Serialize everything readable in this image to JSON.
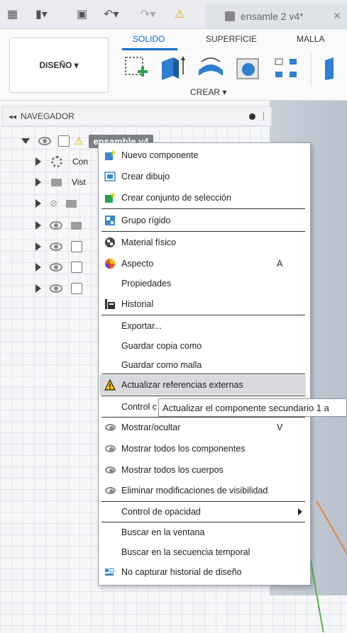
{
  "titlebar": {
    "document_tab": "ensamle 2 v4*",
    "close_glyph": "✕"
  },
  "ribbon": {
    "tabs": [
      "SOLIDO",
      "SUPERFICIE",
      "MALLA"
    ],
    "design_button": "DISEÑO ▾",
    "crear_label": "CREAR ▾"
  },
  "navigator": {
    "title": "NAVEGADOR",
    "root_label": "ensamble v4",
    "rows": [
      "Con",
      "Vist"
    ]
  },
  "menu": {
    "items": [
      {
        "label": "Nuevo componente",
        "icon": "new-component-icon"
      },
      {
        "label": "Crear dibujo",
        "icon": "create-drawing-icon"
      },
      {
        "label": "Crear conjunto de selección",
        "icon": "selection-set-icon"
      },
      {
        "label": "Grupo rígido",
        "icon": "rigid-group-icon"
      },
      {
        "label": "Material físico",
        "icon": "physical-material-icon"
      },
      {
        "label": "Aspecto",
        "icon": "appearance-icon",
        "shortcut": "A"
      },
      {
        "label": "Propiedades"
      },
      {
        "label": "Historial",
        "icon": "history-icon"
      },
      {
        "label": "Exportar..."
      },
      {
        "label": "Guardar copia como"
      },
      {
        "label": "Guardar como malla"
      },
      {
        "label": "Actualizar referencias externas",
        "icon": "warning-icon"
      },
      {
        "label": "Control c"
      },
      {
        "label": "Mostrar/ocultar",
        "icon": "eye-icon",
        "shortcut": "V"
      },
      {
        "label": "Mostrar todos los componentes",
        "icon": "eye-icon"
      },
      {
        "label": "Mostrar todos los cuerpos",
        "icon": "eye-icon"
      },
      {
        "label": "Eliminar modificaciones de visibilidad",
        "icon": "eye-icon"
      },
      {
        "label": "Control de opacidad"
      },
      {
        "label": "Buscar en la ventana"
      },
      {
        "label": "Buscar en la secuencia temporal"
      },
      {
        "label": "No capturar historial de diseño",
        "icon": "no-history-icon"
      }
    ]
  },
  "tooltip": "Actualizar el componente secundario 1 a",
  "colors": {
    "accent": "#0b6ec7",
    "warning": "#f3c400",
    "highlight": "#d9dadd"
  }
}
